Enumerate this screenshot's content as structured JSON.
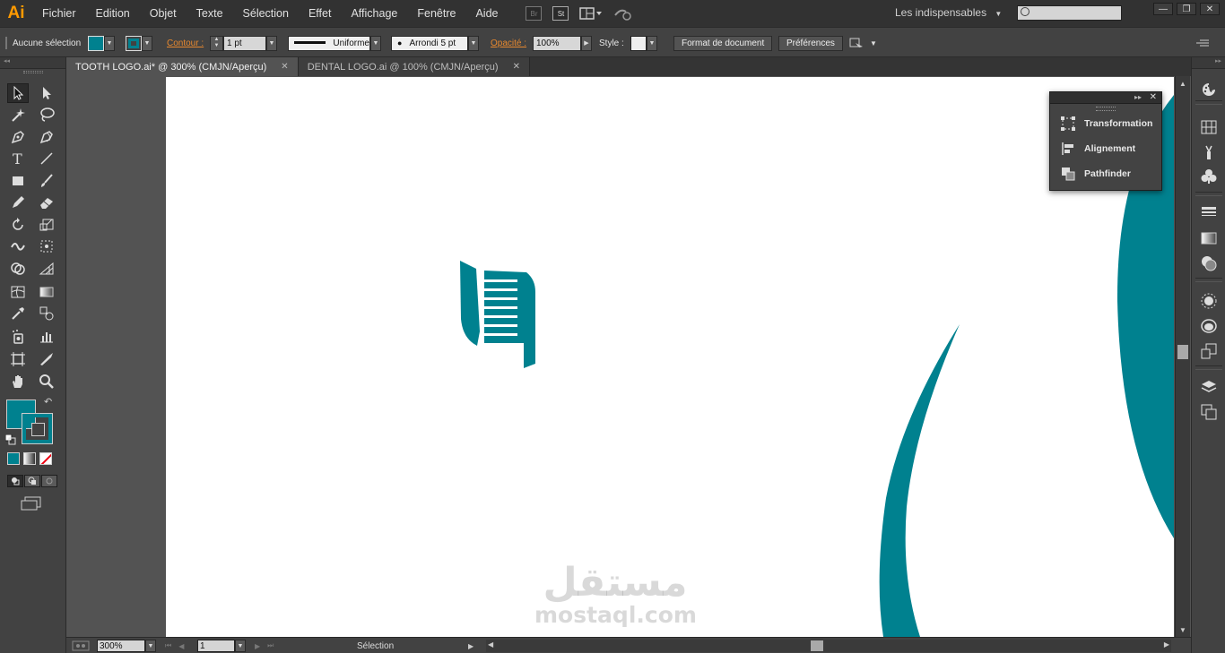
{
  "menubar": {
    "app_logo": "Ai",
    "items": [
      "Fichier",
      "Edition",
      "Objet",
      "Texte",
      "Sélection",
      "Effet",
      "Affichage",
      "Fenêtre",
      "Aide"
    ],
    "bridge_label": "Br",
    "stock_label": "St",
    "workspace": "Les indispensables",
    "search_placeholder": ""
  },
  "control": {
    "selection_label": "Aucune sélection",
    "stroke_label": "Contour :",
    "stroke_weight": "1 pt",
    "profile": "Uniforme",
    "brush": "Arrondi 5 pt",
    "opacity_label": "Opacité :",
    "opacity_value": "100%",
    "style_label": "Style :",
    "doc_setup_button": "Format de document",
    "preferences_button": "Préférences"
  },
  "tabs": [
    {
      "label": "TOOTH LOGO.ai* @ 300% (CMJN/Aperçu)",
      "active": true
    },
    {
      "label": "DENTAL LOGO.ai @ 100% (CMJN/Aperçu)",
      "active": false
    }
  ],
  "panel": {
    "items": [
      "Transformation",
      "Alignement",
      "Pathfinder"
    ]
  },
  "status": {
    "zoom": "300%",
    "artboard": "1",
    "tool_info": "Sélection"
  },
  "watermark": {
    "arabic": "مستقل",
    "latin": "mostaql.com"
  },
  "colors": {
    "fill": "#00818f",
    "ui_dark": "#323232",
    "ui_panel": "#424242"
  }
}
